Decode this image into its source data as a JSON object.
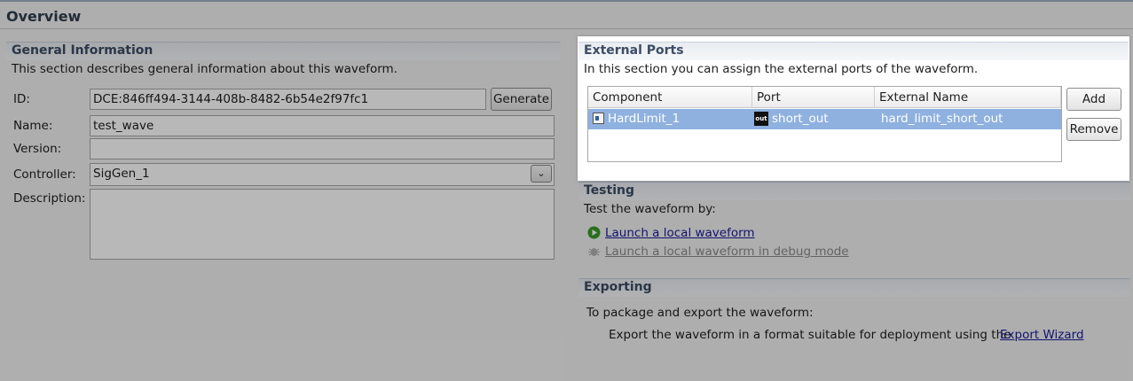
{
  "overview": {
    "title": "Overview"
  },
  "general": {
    "title": "General Information",
    "description": "This section describes general information about this waveform.",
    "id_label": "ID:",
    "id_value": "DCE:846ff494-3144-408b-8482-6b54e2f97fc1",
    "generate_label": "Generate",
    "name_label": "Name:",
    "name_value": "test_wave",
    "version_label": "Version:",
    "version_value": "",
    "controller_label": "Controller:",
    "controller_value": "SigGen_1",
    "description_label": "Description:",
    "description_value": ""
  },
  "external_ports": {
    "title": "External Ports",
    "description": "In this section you can assign the external ports of the waveform.",
    "columns": [
      "Component",
      "Port",
      "External Name"
    ],
    "rows": [
      {
        "component": "HardLimit_1",
        "port_icon_text": "out",
        "port": "short_out",
        "external_name": "hard_limit_short_out"
      }
    ],
    "add_label": "Add",
    "remove_label": "Remove"
  },
  "testing": {
    "title": "Testing",
    "description": "Test the waveform by:",
    "launch_local": "Launch a local waveform",
    "launch_debug": "Launch a local waveform in debug mode"
  },
  "exporting": {
    "title": "Exporting",
    "description": "To package and export the waveform:",
    "export_text": "Export the waveform in a format suitable for deployment using the",
    "export_link": "Export Wizard"
  },
  "icons": {
    "launch": "play-icon",
    "debug": "bug-icon",
    "component": "component-icon",
    "port": "port-out-icon",
    "combo": "chevron-down-icon"
  },
  "colors": {
    "selection": "#8fb1df",
    "section_title": "#3c4c64",
    "link": "#1a1a9a",
    "play_green": "#3b9a2a"
  }
}
